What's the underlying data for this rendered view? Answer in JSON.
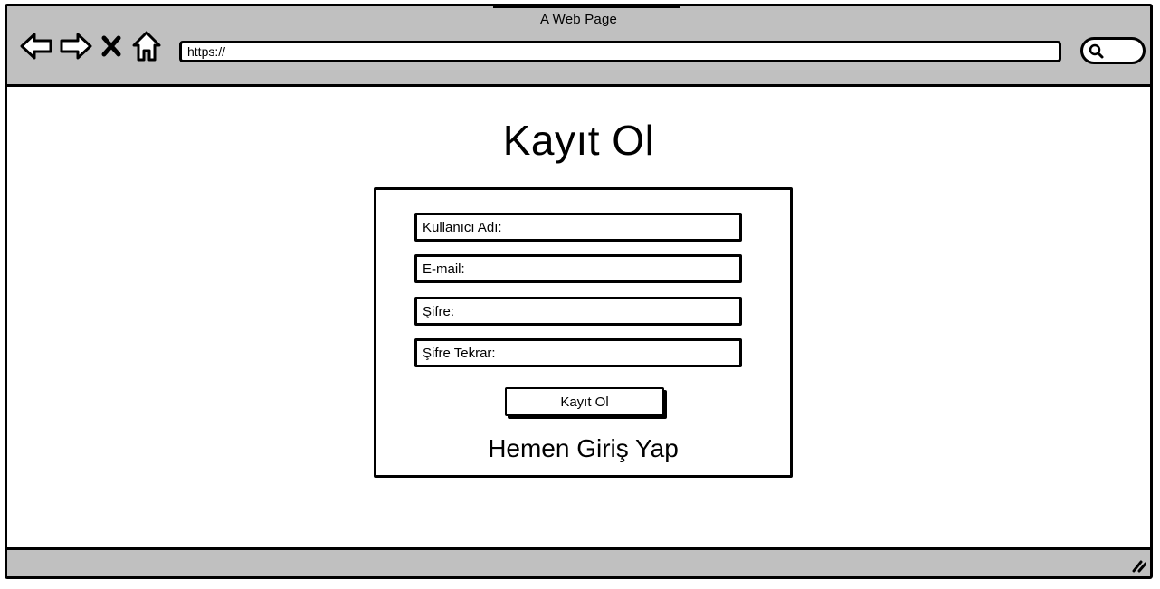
{
  "window": {
    "title": "A Web Page"
  },
  "toolbar": {
    "icons": [
      "back-arrow-icon",
      "forward-arrow-icon",
      "close-icon",
      "home-icon"
    ],
    "address": "https://",
    "search_icon": "search-icon"
  },
  "main": {
    "heading": "Kayıt Ol",
    "form": {
      "fields": [
        {
          "label": "Kullanıcı Adı:"
        },
        {
          "label": "E-mail:"
        },
        {
          "label": "Şifre:"
        },
        {
          "label": "Şifre Tekrar:"
        }
      ],
      "submit_label": "Kayıt Ol",
      "login_link": "Hemen Giriş Yap"
    }
  },
  "statusbar": {
    "grip_icon": "resize-grip-icon"
  },
  "colors": {
    "chrome": "#c0c0c0",
    "stroke": "#000000",
    "background": "#ffffff"
  }
}
